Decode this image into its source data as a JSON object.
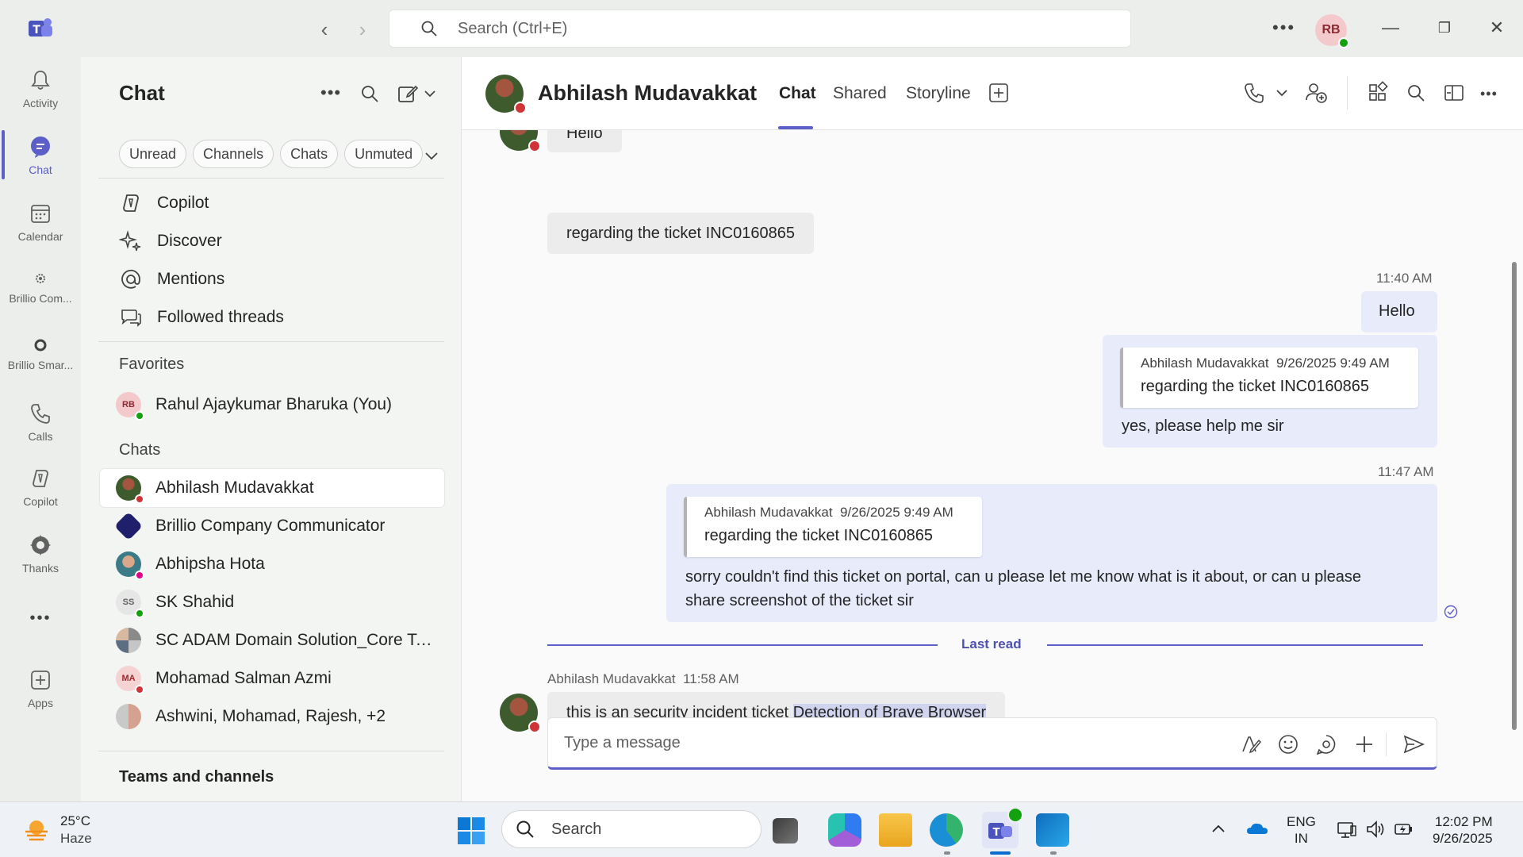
{
  "titlebar": {
    "search_placeholder": "Search (Ctrl+E)",
    "user_initials": "RB"
  },
  "rail": {
    "items": [
      {
        "label": "Activity",
        "icon": "bell-icon"
      },
      {
        "label": "Chat",
        "icon": "chat-icon"
      },
      {
        "label": "Calendar",
        "icon": "calendar-icon"
      },
      {
        "label": "Brillio Com...",
        "icon": "app-icon"
      },
      {
        "label": "Brillio Smar...",
        "icon": "app-icon"
      },
      {
        "label": "Calls",
        "icon": "phone-icon"
      },
      {
        "label": "Copilot",
        "icon": "copilot-icon"
      },
      {
        "label": "Thanks",
        "icon": "badge-icon"
      },
      {
        "label": "Apps",
        "icon": "apps-icon"
      }
    ],
    "more": "•••"
  },
  "chatpane": {
    "title": "Chat",
    "filters": [
      "Unread",
      "Channels",
      "Chats",
      "Unmuted"
    ],
    "nav": [
      {
        "label": "Copilot",
        "icon": "copilot-icon"
      },
      {
        "label": "Discover",
        "icon": "sparkle-icon"
      },
      {
        "label": "Mentions",
        "icon": "at-icon"
      },
      {
        "label": "Followed threads",
        "icon": "threads-icon"
      }
    ],
    "favorites_heading": "Favorites",
    "favorites": [
      {
        "name": "Rahul Ajaykumar Bharuka (You)",
        "initials": "RB",
        "presence": "green"
      }
    ],
    "chats_heading": "Chats",
    "chats": [
      {
        "name": "Abhilash Mudavakkat",
        "initials": "",
        "presence": "red",
        "selected": true
      },
      {
        "name": "Brillio Company Communicator",
        "initials": "",
        "presence": "",
        "selected": false
      },
      {
        "name": "Abhipsha Hota",
        "initials": "",
        "presence": "pink",
        "selected": false
      },
      {
        "name": "SK Shahid",
        "initials": "SS",
        "presence": "green",
        "selected": false
      },
      {
        "name": "SC ADAM Domain Solution_Core Tea...",
        "initials": "",
        "presence": "",
        "selected": false
      },
      {
        "name": "Mohamad Salman Azmi",
        "initials": "MA",
        "presence": "red",
        "selected": false
      },
      {
        "name": "Ashwini, Mohamad, Rajesh, +2",
        "initials": "",
        "presence": "",
        "selected": false
      }
    ],
    "teams_heading": "Teams and channels"
  },
  "conversation": {
    "name": "Abhilash Mudavakkat",
    "tabs": [
      "Chat",
      "Shared",
      "Storyline"
    ],
    "messages": {
      "in_hello": "Hello",
      "in_ticket": "regarding the ticket INC0160865",
      "out_time_1": "11:40 AM",
      "out_hello": "Hello",
      "quote_author": "Abhilash Mudavakkat",
      "quote_time": "9/26/2025 9:49 AM",
      "quote_text": "regarding the ticket INC0160865",
      "out_reply_1": "yes, please help me sir",
      "out_time_2": "11:47 AM",
      "out_reply_2_line1": "sorry couldn't find this ticket on portal, can u please let me know what is it about, or can u please",
      "out_reply_2_line2": "share screenshot of the ticket sir",
      "last_read": "Last read",
      "in_author": "Abhilash Mudavakkat",
      "in_time": "11:58 AM",
      "in_last_prefix": "this is an security incident ticket ",
      "in_last_highlight": "Detection of Brave Browser"
    },
    "compose_placeholder": "Type a message"
  },
  "taskbar": {
    "temp": "25°C",
    "weather": "Haze",
    "search_placeholder": "Search",
    "lang_line1": "ENG",
    "lang_line2": "IN",
    "time": "12:02 PM",
    "date": "9/26/2025"
  },
  "colors": {
    "accent": "#5b5fc7",
    "presence_busy": "#d13438",
    "presence_available": "#13a10e",
    "bubble_out": "#e8ebfa",
    "bubble_in": "#ececec"
  }
}
